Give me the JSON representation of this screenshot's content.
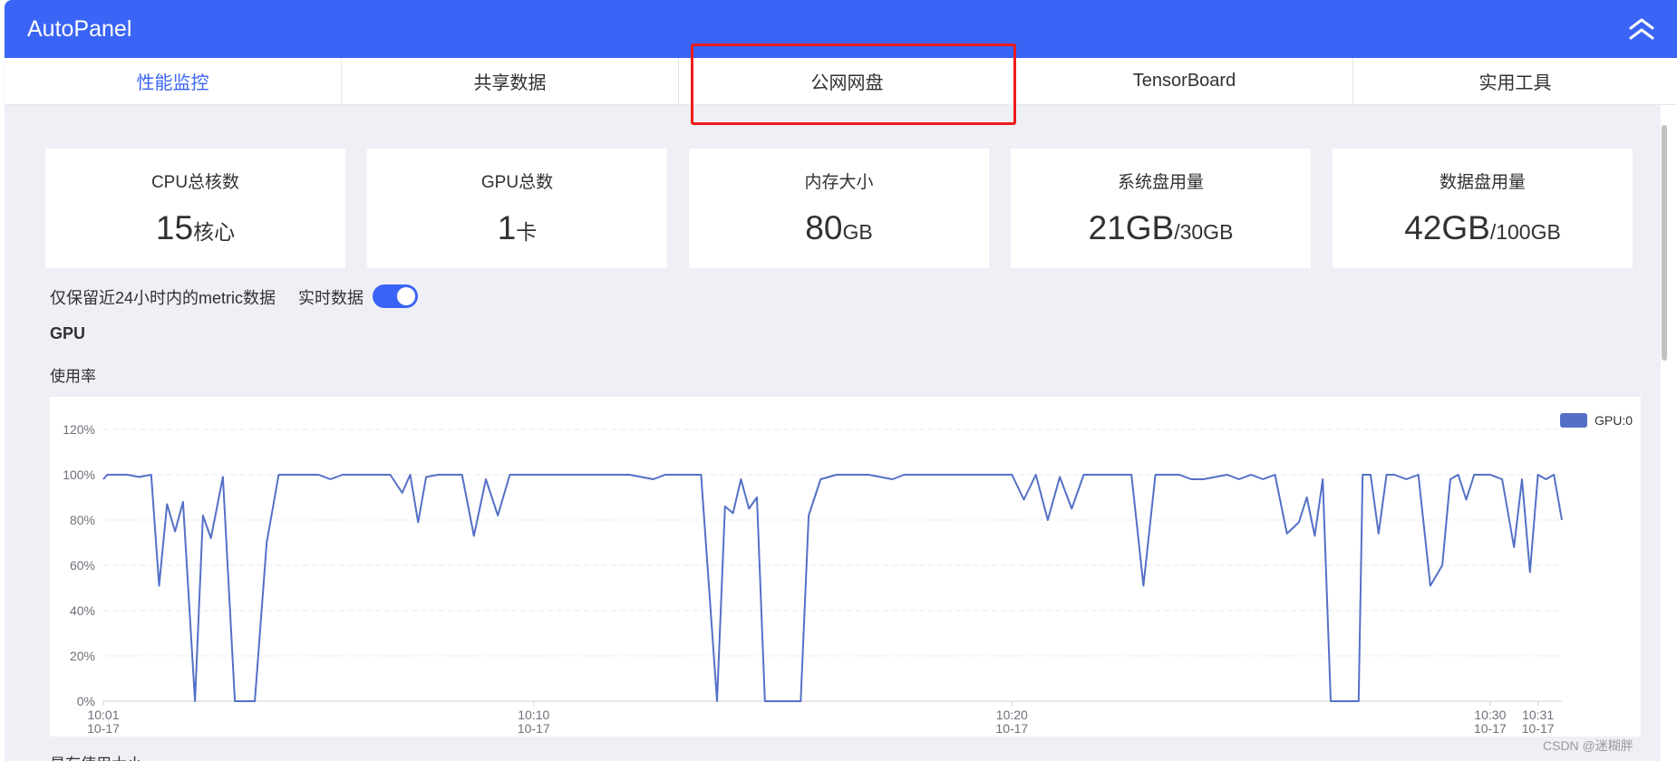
{
  "header": {
    "title": "AutoPanel",
    "collapse_icon": "double-chevron-up-icon"
  },
  "tabs": [
    {
      "label": "性能监控",
      "active": true
    },
    {
      "label": "共享数据",
      "active": false
    },
    {
      "label": "公网网盘",
      "active": false
    },
    {
      "label": "TensorBoard",
      "active": false
    },
    {
      "label": "实用工具",
      "active": false
    }
  ],
  "cards": [
    {
      "title": "CPU总核数",
      "value": "15",
      "unit": "核心"
    },
    {
      "title": "GPU总数",
      "value": "1",
      "unit": "卡"
    },
    {
      "title": "内存大小",
      "value": "80",
      "unit": "GB"
    },
    {
      "title": "系统盘用量",
      "value": "21GB",
      "unit": "/30GB"
    },
    {
      "title": "数据盘用量",
      "value": "42GB",
      "unit": "/100GB"
    }
  ],
  "controls": {
    "retain_note": "仅保留近24小时内的metric数据",
    "realtime_label": "实时数据",
    "realtime_on": true
  },
  "section": {
    "title": "GPU",
    "subtitle": "使用率",
    "next_subtitle": "显存使用大小"
  },
  "colors": {
    "accent": "#3a64f5",
    "series": "#5470c6",
    "highlight": "#f01a1a"
  },
  "watermark": "CSDN @迷糊胖",
  "chart_data": {
    "type": "line",
    "title": "",
    "xlabel": "",
    "ylabel": "",
    "ylim": [
      0,
      120
    ],
    "y_ticks": [
      0,
      20,
      40,
      60,
      80,
      100,
      120
    ],
    "y_tick_suffix": "%",
    "x_range": [
      "10:01",
      "10:31"
    ],
    "x_tick_labels": [
      {
        "time": "10:01",
        "date": "10-17"
      },
      {
        "time": "10:10",
        "date": "10-17"
      },
      {
        "time": "10:20",
        "date": "10-17"
      },
      {
        "time": "10:30",
        "date": "10-17"
      },
      {
        "time": "10:31",
        "date": "10-17"
      }
    ],
    "grid": true,
    "legend_position": "top-right",
    "series": [
      {
        "name": "GPU:0",
        "points": [
          [
            "10:01:00",
            98
          ],
          [
            "10:01:05",
            100
          ],
          [
            "10:01:15",
            100
          ],
          [
            "10:01:30",
            100
          ],
          [
            "10:01:45",
            99
          ],
          [
            "10:02:00",
            100
          ],
          [
            "10:02:10",
            51
          ],
          [
            "10:02:20",
            87
          ],
          [
            "10:02:30",
            75
          ],
          [
            "10:02:40",
            88
          ],
          [
            "10:02:55",
            0
          ],
          [
            "10:03:05",
            82
          ],
          [
            "10:03:15",
            72
          ],
          [
            "10:03:30",
            99
          ],
          [
            "10:03:45",
            0
          ],
          [
            "10:04:00",
            0
          ],
          [
            "10:04:10",
            0
          ],
          [
            "10:04:25",
            70
          ],
          [
            "10:04:40",
            100
          ],
          [
            "10:05:30",
            100
          ],
          [
            "10:05:45",
            98
          ],
          [
            "10:06:00",
            100
          ],
          [
            "10:07:00",
            100
          ],
          [
            "10:07:15",
            92
          ],
          [
            "10:07:25",
            100
          ],
          [
            "10:07:35",
            79
          ],
          [
            "10:07:45",
            99
          ],
          [
            "10:08:00",
            100
          ],
          [
            "10:08:30",
            100
          ],
          [
            "10:08:45",
            73
          ],
          [
            "10:09:00",
            98
          ],
          [
            "10:09:15",
            82
          ],
          [
            "10:09:30",
            100
          ],
          [
            "10:10:00",
            100
          ],
          [
            "10:11:00",
            100
          ],
          [
            "10:12:00",
            100
          ],
          [
            "10:12:30",
            98
          ],
          [
            "10:12:45",
            100
          ],
          [
            "10:13:00",
            100
          ],
          [
            "10:13:30",
            100
          ],
          [
            "10:13:50",
            0
          ],
          [
            "10:14:00",
            86
          ],
          [
            "10:14:10",
            83
          ],
          [
            "10:14:20",
            98
          ],
          [
            "10:14:30",
            85
          ],
          [
            "10:14:40",
            90
          ],
          [
            "10:14:50",
            0
          ],
          [
            "10:15:00",
            0
          ],
          [
            "10:15:20",
            0
          ],
          [
            "10:15:35",
            0
          ],
          [
            "10:15:45",
            82
          ],
          [
            "10:16:00",
            98
          ],
          [
            "10:16:20",
            100
          ],
          [
            "10:17:00",
            100
          ],
          [
            "10:17:30",
            98
          ],
          [
            "10:17:45",
            100
          ],
          [
            "10:18:00",
            100
          ],
          [
            "10:19:00",
            100
          ],
          [
            "10:20:00",
            100
          ],
          [
            "10:20:15",
            89
          ],
          [
            "10:20:30",
            100
          ],
          [
            "10:20:45",
            80
          ],
          [
            "10:21:00",
            99
          ],
          [
            "10:21:15",
            85
          ],
          [
            "10:21:30",
            100
          ],
          [
            "10:22:00",
            100
          ],
          [
            "10:22:30",
            100
          ],
          [
            "10:22:45",
            51
          ],
          [
            "10:23:00",
            100
          ],
          [
            "10:23:30",
            100
          ],
          [
            "10:23:45",
            98
          ],
          [
            "10:24:00",
            98
          ],
          [
            "10:24:30",
            100
          ],
          [
            "10:24:45",
            98
          ],
          [
            "10:25:00",
            100
          ],
          [
            "10:25:15",
            98
          ],
          [
            "10:25:30",
            100
          ],
          [
            "10:25:45",
            74
          ],
          [
            "10:26:00",
            79
          ],
          [
            "10:26:10",
            90
          ],
          [
            "10:26:20",
            73
          ],
          [
            "10:26:30",
            98
          ],
          [
            "10:26:40",
            0
          ],
          [
            "10:27:00",
            0
          ],
          [
            "10:27:15",
            0
          ],
          [
            "10:27:20",
            100
          ],
          [
            "10:27:30",
            100
          ],
          [
            "10:27:40",
            74
          ],
          [
            "10:27:50",
            100
          ],
          [
            "10:28:00",
            100
          ],
          [
            "10:28:15",
            98
          ],
          [
            "10:28:30",
            100
          ],
          [
            "10:28:45",
            51
          ],
          [
            "10:29:00",
            60
          ],
          [
            "10:29:10",
            98
          ],
          [
            "10:29:20",
            100
          ],
          [
            "10:29:30",
            89
          ],
          [
            "10:29:40",
            100
          ],
          [
            "10:30:00",
            100
          ],
          [
            "10:30:15",
            98
          ],
          [
            "10:30:30",
            68
          ],
          [
            "10:30:40",
            98
          ],
          [
            "10:30:50",
            57
          ],
          [
            "10:31:00",
            100
          ],
          [
            "10:31:10",
            98
          ],
          [
            "10:31:20",
            100
          ],
          [
            "10:31:30",
            80
          ]
        ]
      }
    ]
  }
}
